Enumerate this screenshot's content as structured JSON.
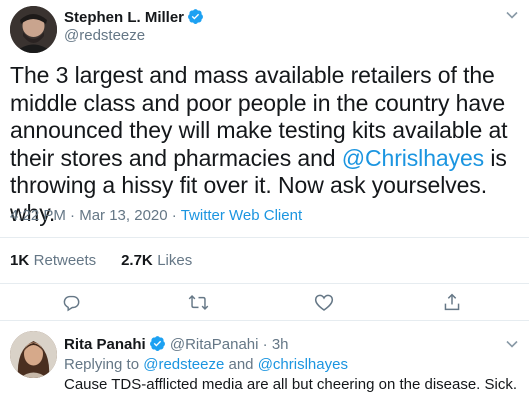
{
  "tweet": {
    "author_name": "Stephen L. Miller",
    "author_handle": "@redsteeze",
    "text_parts": {
      "before_mention": "The 3 largest and mass available retailers of the middle class and poor people in the country have announced they will make testing kits available at their stores and pharmacies and ",
      "mention": "@Chrislhayes",
      "after_mention": " is throwing a hissy fit over it. Now ask yourselves. why."
    },
    "time": "4:22 PM",
    "date": "Mar 13, 2020",
    "separator": "·",
    "client": "Twitter Web Client",
    "stats": {
      "retweets_count": "1K",
      "retweets_label": "Retweets",
      "likes_count": "2.7K",
      "likes_label": "Likes"
    },
    "actions": [
      "reply-icon",
      "retweet-icon",
      "like-icon",
      "share-icon"
    ]
  },
  "reply": {
    "author_name": "Rita Panahi",
    "author_handle": "@RitaPanahi",
    "separator": "·",
    "age": "3h",
    "replying_prefix": "Replying to ",
    "replying_to_1": "@redsteeze",
    "replying_and": " and ",
    "replying_to_2": "@chrislhayes",
    "text": "Cause TDS-afflicted media are all but cheering on the disease. Sick."
  },
  "colors": {
    "accent": "#1b95e0",
    "muted": "#657786",
    "text": "#14171a",
    "divider": "#e6ecf0"
  }
}
